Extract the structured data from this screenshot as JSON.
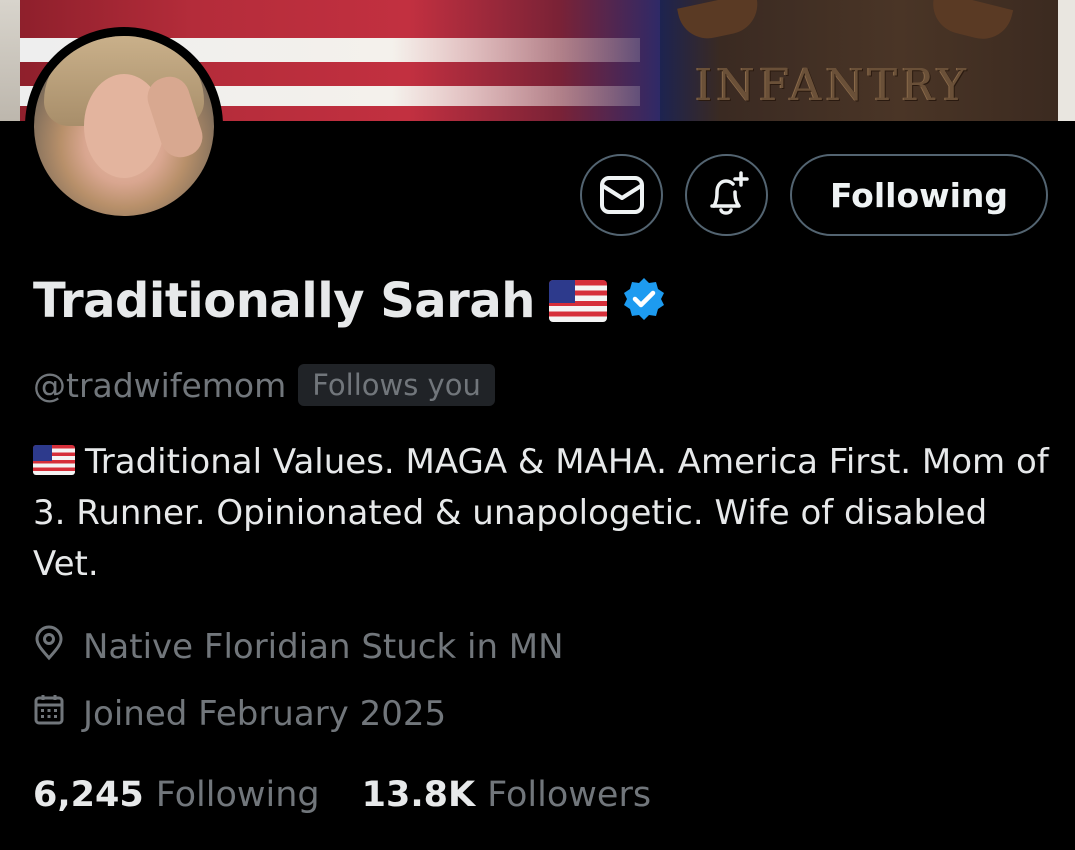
{
  "banner": {
    "emblem_text": "INFANTRY"
  },
  "profile": {
    "display_name": "Traditionally Sarah",
    "name_emoji": "us-flag",
    "verified": true,
    "verified_color": "#1d9bf0",
    "handle": "@tradwifemom",
    "follows_you_label": "Follows you",
    "bio_emoji": "us-flag",
    "bio": "Traditional Values. MAGA & MAHA. America First. Mom of 3. Runner. Opinionated & unapologetic. Wife of disabled Vet.",
    "location": "Native Floridian Stuck in MN",
    "joined": "Joined February 2025"
  },
  "actions": {
    "message_icon": "envelope-icon",
    "notify_icon": "bell-plus-icon",
    "following_label": "Following"
  },
  "stats": {
    "following_count": "6,245",
    "following_label": "Following",
    "followers_count": "13.8K",
    "followers_label": "Followers"
  },
  "colors": {
    "background": "#000000",
    "primary_text": "#e7e9ea",
    "secondary_text": "#71767b",
    "border": "#536471",
    "verified": "#1d9bf0"
  }
}
